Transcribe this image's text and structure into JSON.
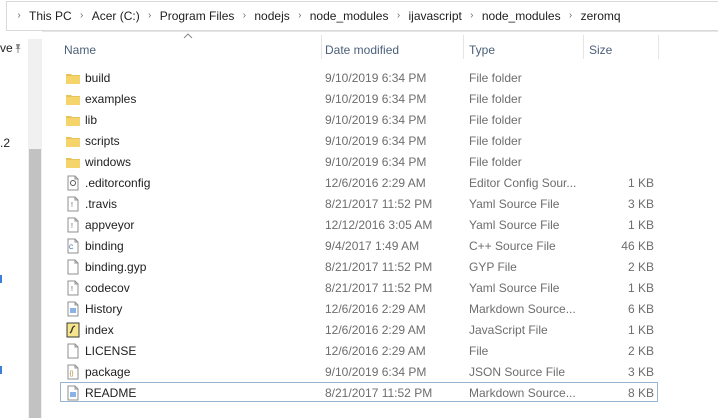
{
  "breadcrumb": [
    "This PC",
    "Acer (C:)",
    "Program Files",
    "nodejs",
    "node_modules",
    "ijavascript",
    "node_modules",
    "zeromq"
  ],
  "nav": {
    "fragments": [
      "ve",
      ".2",
      "s",
      "t",
      "s"
    ]
  },
  "columns": {
    "name": "Name",
    "date_modified": "Date modified",
    "type": "Type",
    "size": "Size"
  },
  "files": [
    {
      "name": "build",
      "date": "9/10/2019 6:34 PM",
      "type": "File folder",
      "size": "",
      "icon": "folder-icon"
    },
    {
      "name": "examples",
      "date": "9/10/2019 6:34 PM",
      "type": "File folder",
      "size": "",
      "icon": "folder-icon"
    },
    {
      "name": "lib",
      "date": "9/10/2019 6:34 PM",
      "type": "File folder",
      "size": "",
      "icon": "folder-icon"
    },
    {
      "name": "scripts",
      "date": "9/10/2019 6:34 PM",
      "type": "File folder",
      "size": "",
      "icon": "folder-icon"
    },
    {
      "name": "windows",
      "date": "9/10/2019 6:34 PM",
      "type": "File folder",
      "size": "",
      "icon": "folder-icon"
    },
    {
      "name": ".editorconfig",
      "date": "12/6/2016 2:29 AM",
      "type": "Editor Config Sour...",
      "size": "1 KB",
      "icon": "config-file-icon"
    },
    {
      "name": ".travis",
      "date": "8/21/2017 11:52 PM",
      "type": "Yaml Source File",
      "size": "3 KB",
      "icon": "yaml-file-icon"
    },
    {
      "name": "appveyor",
      "date": "12/12/2016 3:05 AM",
      "type": "Yaml Source File",
      "size": "1 KB",
      "icon": "yaml-file-icon"
    },
    {
      "name": "binding",
      "date": "9/4/2017 1:49 AM",
      "type": "C++ Source File",
      "size": "46 KB",
      "icon": "cpp-file-icon"
    },
    {
      "name": "binding.gyp",
      "date": "8/21/2017 11:52 PM",
      "type": "GYP File",
      "size": "2 KB",
      "icon": "blank-file-icon"
    },
    {
      "name": "codecov",
      "date": "8/21/2017 11:52 PM",
      "type": "Yaml Source File",
      "size": "1 KB",
      "icon": "yaml-file-icon"
    },
    {
      "name": "History",
      "date": "12/6/2016 2:29 AM",
      "type": "Markdown Source...",
      "size": "6 KB",
      "icon": "markdown-file-icon"
    },
    {
      "name": "index",
      "date": "12/6/2016 2:29 AM",
      "type": "JavaScript File",
      "size": "1 KB",
      "icon": "javascript-file-icon"
    },
    {
      "name": "LICENSE",
      "date": "12/6/2016 2:29 AM",
      "type": "File",
      "size": "2 KB",
      "icon": "blank-file-icon"
    },
    {
      "name": "package",
      "date": "9/10/2019 6:34 PM",
      "type": "JSON Source File",
      "size": "3 KB",
      "icon": "json-file-icon"
    },
    {
      "name": "README",
      "date": "8/21/2017 11:52 PM",
      "type": "Markdown Source...",
      "size": "8 KB",
      "icon": "markdown-file-icon"
    }
  ],
  "colors": {
    "header_text": "#4c607a",
    "folder": "#e8c25a",
    "focus_border": "#99b4d1",
    "nav_link": "#3c7fd6"
  }
}
